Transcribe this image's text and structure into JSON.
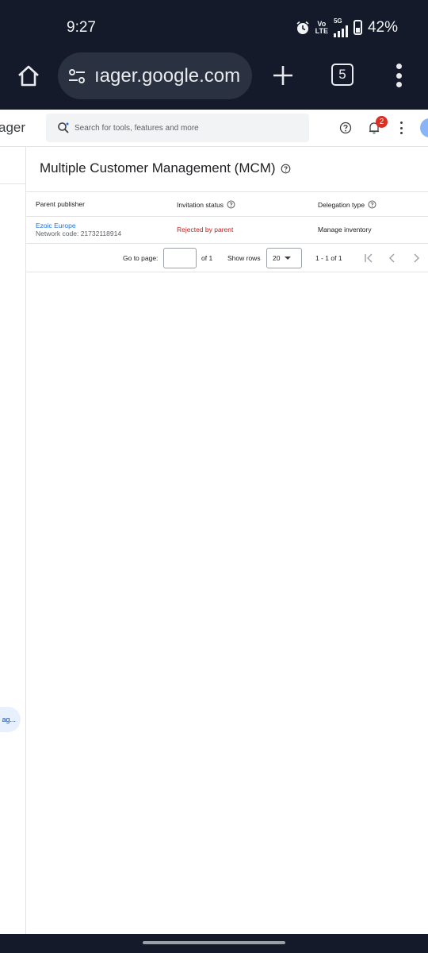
{
  "status_bar": {
    "time": "9:27",
    "volte_line1": "Vo",
    "volte_line2": "LTE",
    "network": "5G",
    "battery": "42%",
    "battery_level": 0.42,
    "icons": [
      "alarm-icon",
      "volte-icon",
      "signal-icon",
      "battery-icon"
    ]
  },
  "browser": {
    "url": "ıager.google.com",
    "tab_count": "5",
    "icons": [
      "home-icon",
      "tune-icon",
      "plus-icon",
      "tabs-icon",
      "overflow-menu-icon"
    ]
  },
  "app": {
    "brand_partial": "ager",
    "search_placeholder": "Search for tools, features and more",
    "notification_count": "2",
    "rail_chip": "ag..."
  },
  "page": {
    "title": "Multiple Customer Management (MCM)"
  },
  "table": {
    "headers": [
      "Parent publisher",
      "Invitation status",
      "Delegation type"
    ],
    "rows": [
      {
        "publisher": "Ezoic Europe",
        "network_code": "Network code: 21732118914",
        "status": "Rejected by parent",
        "delegation": "Manage inventory"
      }
    ],
    "pagination": {
      "goto_label": "Go to page:",
      "goto_value": "",
      "of_label": "of 1",
      "rows_label": "Show rows",
      "rows_value": "20",
      "range": "1 - 1 of 1"
    }
  },
  "colors": {
    "system_bar": "#141a29",
    "url_pill": "#2a3140",
    "link": "#1a73e8",
    "rejected": "#c5221f",
    "badge": "#d93025"
  }
}
